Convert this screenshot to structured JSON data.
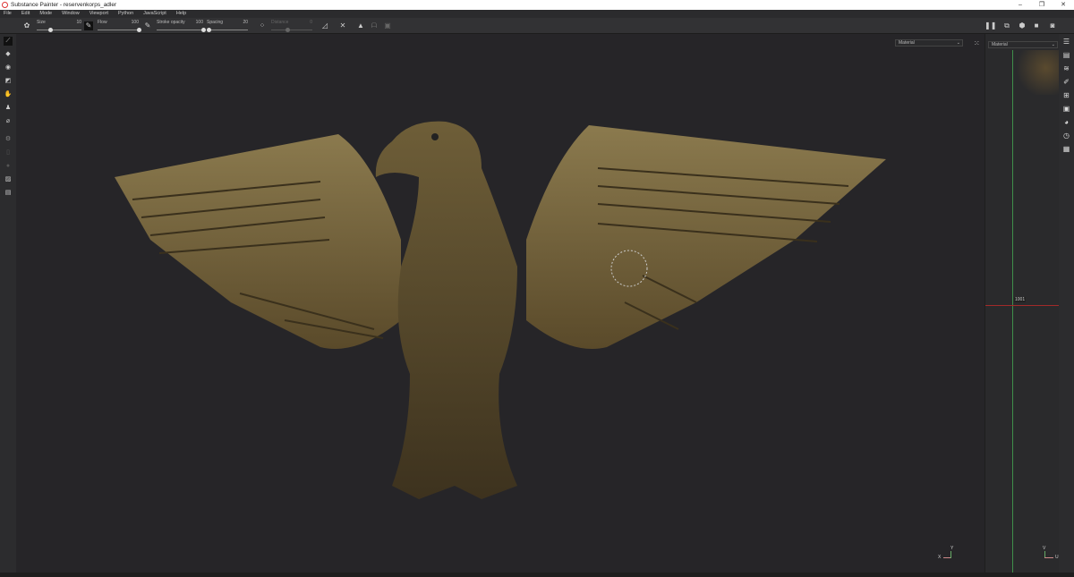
{
  "window": {
    "title": "Substance Painter - reservenkorps_adler",
    "minimize": "–",
    "restore": "❐",
    "close": "✕"
  },
  "menu": [
    "File",
    "Edit",
    "Mode",
    "Window",
    "Viewport",
    "Python",
    "JavaScript",
    "Help"
  ],
  "toolbar": {
    "size": {
      "label": "Size",
      "value": "10",
      "fraction": 0.3
    },
    "flow": {
      "label": "Flow",
      "value": "100",
      "fraction": 1.0
    },
    "stroke_opacity": {
      "label": "Stroke opacity",
      "value": "100",
      "fraction": 1.0
    },
    "spacing": {
      "label": "Spacing",
      "value": "20",
      "fraction": 0.05
    },
    "distance": {
      "label": "Distance",
      "value": "0",
      "fraction": 0.4,
      "disabled": true
    }
  },
  "viewport": {
    "channel_3d": "Material",
    "channel_2d": "Material",
    "uv_tile": "1001",
    "axis_3d": {
      "x": "X",
      "y": "Y"
    },
    "axis_2d": {
      "u": "U",
      "v": "V"
    },
    "accent_green": "#3f8f4a",
    "accent_red": "#a22a2a"
  }
}
